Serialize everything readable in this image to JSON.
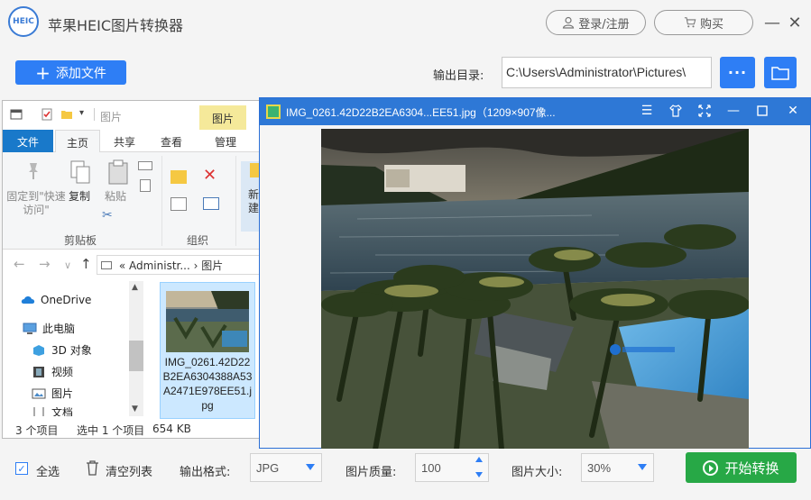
{
  "app": {
    "logo_text": "HEIC",
    "title": "苹果HEIC图片转换器",
    "login_label": "登录/注册",
    "buy_label": "购买",
    "minimize_icon": "—",
    "close_icon": "✕"
  },
  "toolbar": {
    "add_files_label": "添加文件",
    "output_dir_label": "输出目录:",
    "output_dir_value": "C:\\Users\\Administrator\\Pictures\\",
    "more_label": "···"
  },
  "explorer": {
    "title_path": "图片",
    "context_tab": "图片",
    "tabs": [
      "文件",
      "主页",
      "共享",
      "查看",
      "管理"
    ],
    "ribbon": {
      "pin_label": "固定到\"快速访问\"",
      "copy_label": "复制",
      "paste_label": "粘贴",
      "clipboard_group": "剪贴板",
      "organize_group": "组织",
      "new_label": "新建"
    },
    "address": {
      "crumb_1": "Administr...",
      "crumb_2": "图片"
    },
    "tree": [
      "OneDrive",
      "此电脑",
      "3D 对象",
      "视频",
      "图片",
      "文档"
    ],
    "file_name": "IMG_0261.42D22B2EA6304388A53A2471E978EE51.jpg",
    "status": {
      "count": "3 个项目",
      "selected": "选中 1 个项目",
      "size": "654 KB"
    }
  },
  "viewer": {
    "title": "IMG_0261.42D22B2EA6304...EE51.jpg（1209×907像..."
  },
  "bottom": {
    "select_all": "全选",
    "clear_list": "清空列表",
    "format_label": "输出格式:",
    "format_value": "JPG",
    "quality_label": "图片质量:",
    "quality_value": "100",
    "size_label": "图片大小:",
    "size_value": "30%",
    "start_label": "开始转换"
  },
  "colors": {
    "accent": "#2e7ef5",
    "start": "#27a846",
    "viewer_bar": "#2e78d6"
  }
}
